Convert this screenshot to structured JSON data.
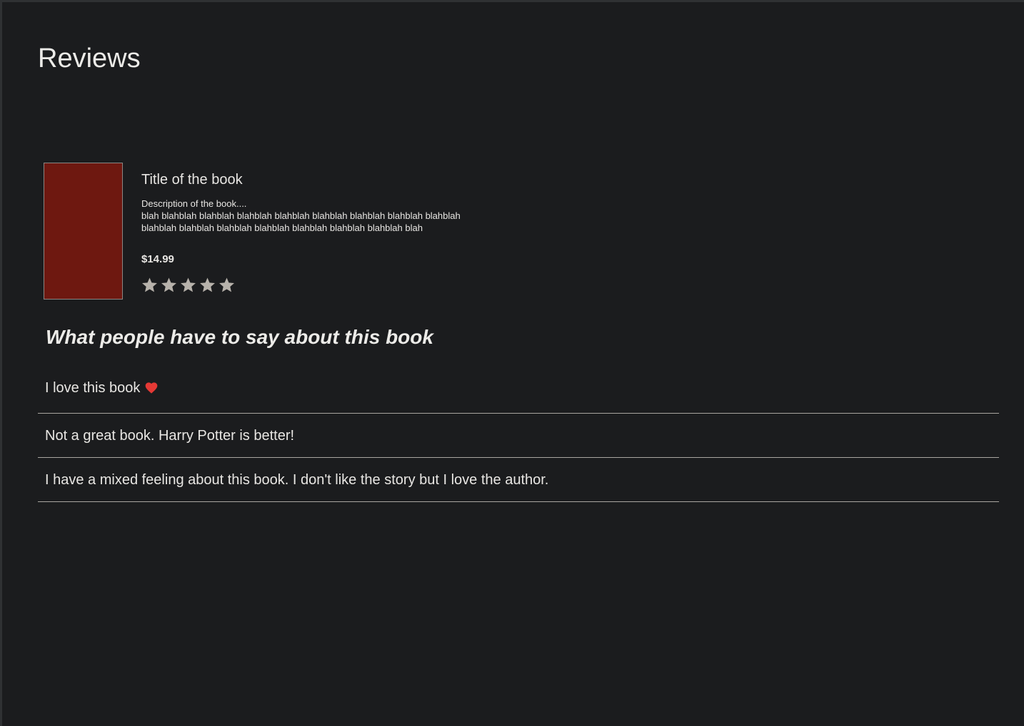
{
  "page": {
    "title": "Reviews"
  },
  "book": {
    "cover_color": "#6e1810",
    "title": "Title of the book",
    "description_lines": [
      "Description of the book....",
      "blah blahblah blahblah blahblah blahblah blahblah blahblah blahblah blahblah",
      "blahblah blahblah blahblah blahblah blahblah blahblah blahblah blah"
    ],
    "price": "$14.99",
    "rating": {
      "max": 5,
      "filled": 0,
      "star_color": "#b7b2ab",
      "icon": "star-icon"
    }
  },
  "reviews_section": {
    "heading": "What people have to say about this book",
    "items": [
      {
        "text": "I love this book",
        "icon": "heart-icon",
        "icon_color": "#e53935"
      },
      {
        "text": "Not a great book. Harry Potter is better!"
      },
      {
        "text": "I have a mixed feeling about this book. I don't like the story but I love the author."
      }
    ]
  }
}
